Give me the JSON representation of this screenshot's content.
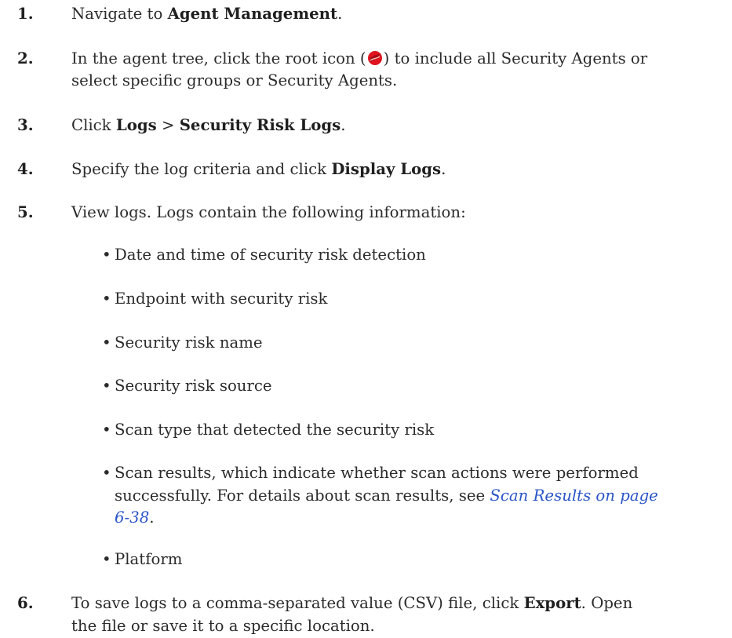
{
  "steps": [
    {
      "number": "1.",
      "pre": "Navigate to ",
      "bold": "Agent Management",
      "post": "."
    },
    {
      "number": "2.",
      "line1_pre": "In the agent tree, click the root icon (",
      "line1_post": ") to include all Security Agents or",
      "line2": "select specific groups or Security Agents.",
      "icon": "trend-micro-root-icon",
      "icon_color": "#e0141e"
    },
    {
      "number": "3.",
      "pre": "Click ",
      "bold1": "Logs",
      "sep": " > ",
      "bold2": "Security Risk Logs",
      "post": "."
    },
    {
      "number": "4.",
      "pre": "Specify the log criteria and click ",
      "bold": "Display Logs",
      "post": "."
    },
    {
      "number": "5.",
      "text": "View logs. Logs contain the following information:",
      "bullets": [
        "Date and time of security risk detection",
        "Endpoint with security risk",
        "Security risk name",
        "Security risk source",
        "Scan type that detected the security risk"
      ],
      "scan_results": {
        "line1": "Scan results, which indicate whether scan actions were performed",
        "line2_pre": "successfully. For details about scan results, see ",
        "link_line2": "Scan Results on page",
        "link_line3": "6-38",
        "line3_post": "."
      },
      "platform": "Platform"
    },
    {
      "number": "6.",
      "line1_pre": "To save logs to a comma-separated value (CSV) file, click ",
      "bold": "Export",
      "line1_post": ". Open",
      "line2": "the file or save it to a specific location."
    }
  ],
  "bullet_glyph": "•",
  "colors": {
    "text": "#2b2b2b",
    "link": "#2a55c8",
    "icon_red": "#e0141e"
  }
}
